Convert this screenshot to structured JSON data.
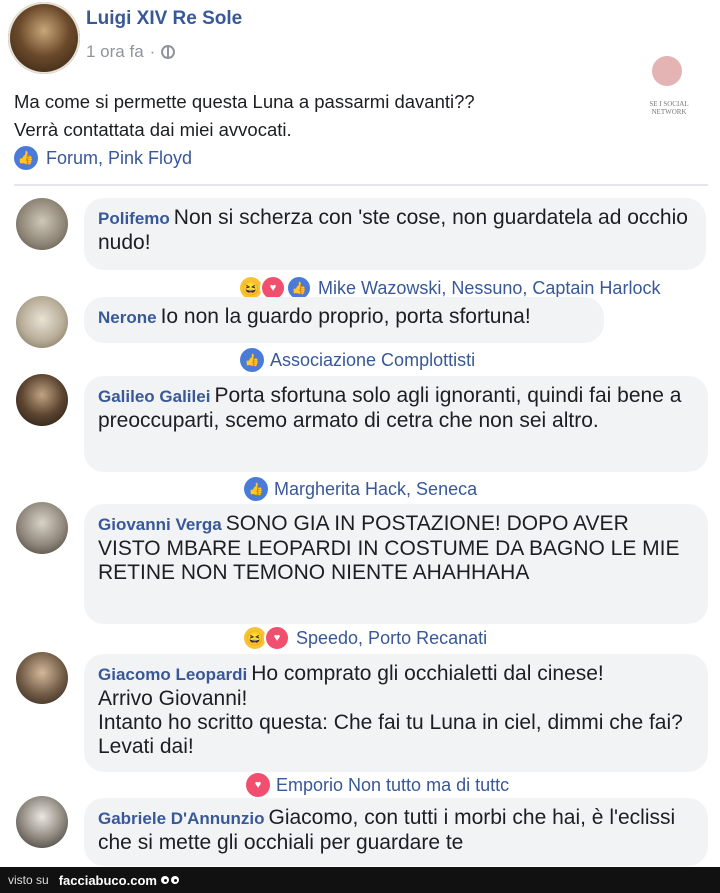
{
  "post": {
    "author": "Luigi XIV Re Sole",
    "time": "1 ora fa",
    "separator": "·",
    "text_line1": "Ma come si permette questa Luna a passarmi davanti??",
    "text_line2": "Verrà contattata dai miei avvocati.",
    "likes": "Forum, Pink Floyd"
  },
  "logo": {
    "text": "SE I SOCIAL NETWORK"
  },
  "comments": [
    {
      "name": "Polifemo",
      "text": "Non si scherza con 'ste cose, non guardatela ad occhio nudo!",
      "reactions": "Mike Wazowski, Nessuno, Captain Harlock"
    },
    {
      "name": "Nerone",
      "text": "Io non la guardo proprio, porta sfortuna!",
      "reactions": "Associazione Complottisti"
    },
    {
      "name": "Galileo Galilei",
      "text": "Porta sfortuna solo agli ignoranti, quindi fai bene a preoccuparti, scemo armato di cetra che non sei altro.",
      "reactions": "Margherita Hack, Seneca"
    },
    {
      "name": "Giovanni Verga",
      "text": "SONO GIA IN POSTAZIONE! DOPO AVER VISTO MBARE LEOPARDI IN COSTUME DA BAGNO LE MIE RETINE NON TEMONO NIENTE AHAHHAHA",
      "reactions": "Speedo, Porto Recanati"
    },
    {
      "name": "Giacomo Leopardi",
      "text": "Ho comprato gli occhialetti dal cinese!",
      "text2": "Arrivo Giovanni!",
      "text3": "Intanto ho scritto questa: Che fai tu Luna in ciel, dimmi che fai? Levati dai!",
      "reactions": "Emporio Non tutto ma di tuttc"
    },
    {
      "name": "Gabriele D'Annunzio",
      "text": "Giacomo, con tutti i morbi che hai, è l'eclissi che si mette gli occhiali per guardare te"
    }
  ],
  "icons": {
    "like": "👍",
    "haha": "😆",
    "love": "♥"
  },
  "footer": {
    "visto": "visto su",
    "site": "facciabuco.com"
  },
  "colors": {
    "link": "#385898",
    "bubble": "#f2f3f5",
    "like": "#4a7bd8",
    "love": "#f0506e",
    "haha": "#f7c234"
  }
}
